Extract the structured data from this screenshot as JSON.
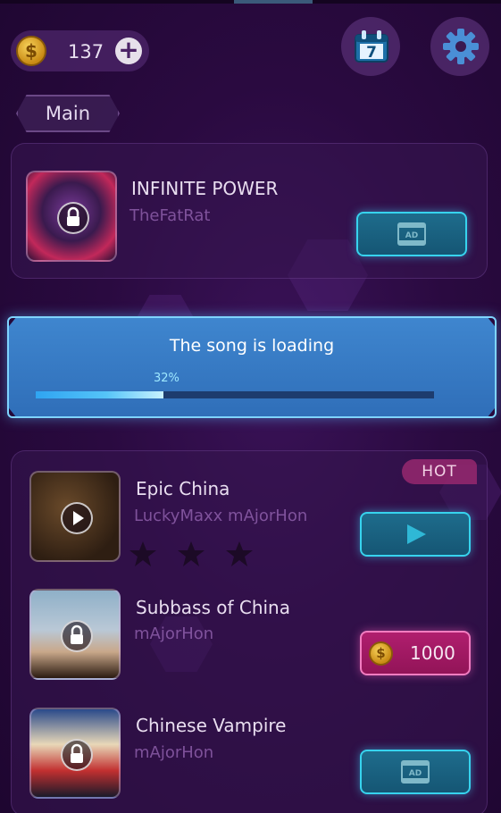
{
  "header": {
    "coins": "137",
    "coin_symbol": "$",
    "calendar_day": "7"
  },
  "tab": {
    "label": "Main"
  },
  "songs": [
    {
      "title": "INFINITE POWER",
      "artist": "TheFatRat",
      "action": "ad",
      "locked": true
    },
    {
      "title": "Epic China",
      "artist": "LuckyMaxx mAjorHon",
      "action": "play",
      "locked": false,
      "badge": "HOT",
      "stars": 3
    },
    {
      "title": "Subbass of China",
      "artist": "mAjorHon",
      "action": "price",
      "price": "1000",
      "locked": true
    },
    {
      "title": "Chinese Vampire",
      "artist": "mAjorHon",
      "action": "ad",
      "locked": true
    }
  ],
  "loading": {
    "message": "The song is loading",
    "percent_label": "32%",
    "progress": 0.32
  },
  "icons": {
    "ad": "AD",
    "lock": "lock-icon",
    "play": "play-icon",
    "gear": "gear-icon",
    "calendar": "calendar-icon"
  },
  "colors": {
    "accent_cyan": "#37d3ee",
    "accent_pink": "#f27cc0",
    "dialog_blue": "#3f86cf"
  }
}
